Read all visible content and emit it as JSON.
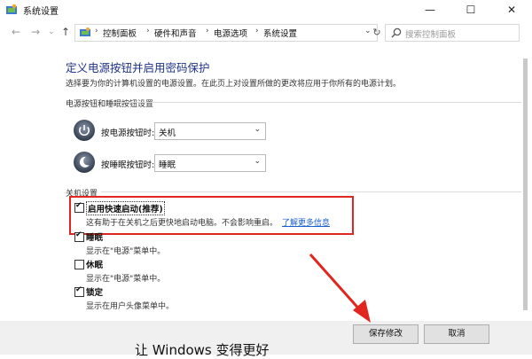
{
  "window": {
    "title": "系统设置",
    "minimize": "—",
    "maximize": "☐",
    "close": "✕"
  },
  "nav": {
    "back": "←",
    "forward": "→",
    "recent": "⌄",
    "up": "↑",
    "breadcrumb": [
      "控制面板",
      "硬件和声音",
      "电源选项",
      "系统设置"
    ],
    "separator": "›",
    "dropdown": "⌄",
    "refresh": "↻",
    "search_placeholder": "搜索控制面板"
  },
  "page": {
    "title": "定义电源按钮并启用密码保护",
    "description": "选择要为你的计算机设置的电源设置。在此页上对设置所做的更改将应用于你所有的电源计划。"
  },
  "power_buttons": {
    "group_label": "电源按钮和睡眠按钮设置",
    "power_label": "按电源按钮时:",
    "power_value": "关机",
    "sleep_label": "按睡眠按钮时:",
    "sleep_value": "睡眠"
  },
  "shutdown": {
    "group_label": "关机设置",
    "options": [
      {
        "label": "启用快速启动(推荐)",
        "checked": true,
        "desc": "这有助于在关机之后更快地启动电脑。不会影响重启。",
        "link": "了解更多信息"
      },
      {
        "label": "睡眠",
        "checked": true,
        "desc": "显示在\"电源\"菜单中。"
      },
      {
        "label": "休眠",
        "checked": false,
        "desc": "显示在\"电源\"菜单中。"
      },
      {
        "label": "锁定",
        "checked": true,
        "desc": "显示在用户头像菜单中。"
      }
    ]
  },
  "buttons": {
    "save": "保存修改",
    "cancel": "取消"
  },
  "background_text": "让 Windows 变得更好",
  "colors": {
    "title_blue": "#1e3287",
    "link_blue": "#1b5fcf",
    "highlight_red": "#e0261e"
  }
}
